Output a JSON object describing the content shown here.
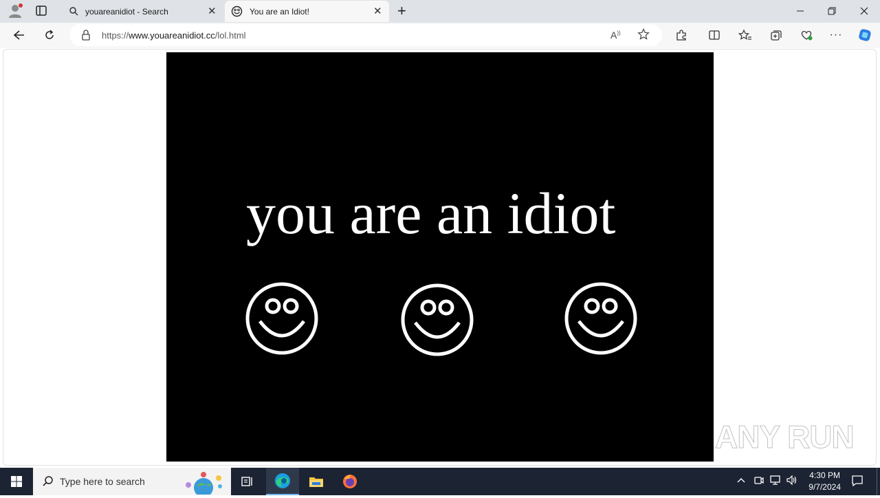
{
  "browser": {
    "tabs": [
      {
        "title": "youareanidiot - Search",
        "icon": "search-icon",
        "active": false
      },
      {
        "title": "You are an Idiot!",
        "icon": "smiley-icon",
        "active": true
      }
    ],
    "new_tab_symbol": "+",
    "address": {
      "scheme": "https://",
      "host": "www.youareanidiot.cc",
      "path": "/lol.html"
    },
    "accent": "#0078d4"
  },
  "page": {
    "background": "#000000",
    "headline": "you are an idiot",
    "faces": [
      "smiley-face",
      "smiley-face",
      "smiley-face"
    ],
    "face_color": "#ffffff"
  },
  "watermark": "ANY RUN",
  "taskbar": {
    "search_placeholder": "Type here to search",
    "apps": [
      "task-view",
      "edge",
      "file-explorer",
      "firefox"
    ],
    "active_app": "edge",
    "time": "4:30 PM",
    "date": "9/7/2024",
    "background": "#1c2333"
  }
}
